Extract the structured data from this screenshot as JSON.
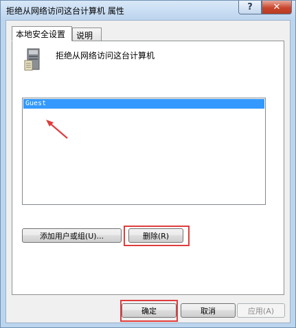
{
  "window": {
    "title": "拒绝从网络访问这台计算机 属性",
    "help_symbol": "?",
    "close_symbol": "✕"
  },
  "tabs": [
    {
      "label": "本地安全设置",
      "active": true
    },
    {
      "label": "说明",
      "active": false
    }
  ],
  "policy": {
    "icon": "server-icon",
    "title": "拒绝从网络访问这台计算机"
  },
  "list": {
    "items": [
      {
        "label": "Guest",
        "selected": true
      }
    ]
  },
  "buttons": {
    "add_label": "添加用户或组(U)...",
    "remove_label": "删除(R)",
    "ok_label": "确定",
    "cancel_label": "取消",
    "apply_label": "应用(A)"
  },
  "colors": {
    "selection": "#3399ff",
    "annotation": "#e03c3c"
  }
}
